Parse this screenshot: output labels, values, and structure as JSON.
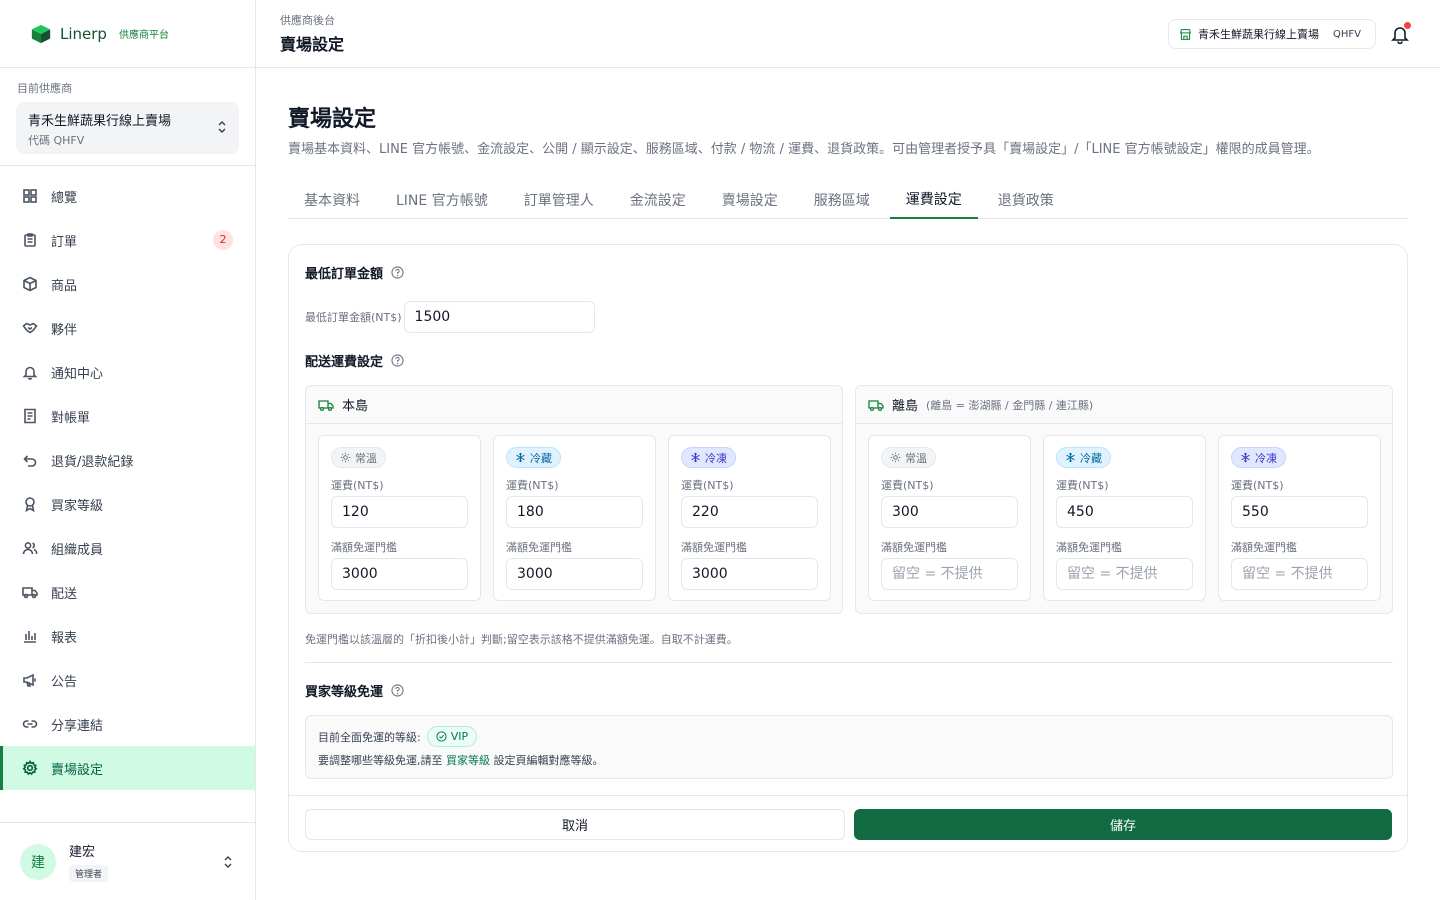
{
  "brand": {
    "name": "Linerp",
    "sub": "供應商平台"
  },
  "supplier": {
    "label": "目前供應商",
    "name": "青禾生鮮蔬果行線上賣場",
    "code": "代碼 QHFV"
  },
  "nav": [
    {
      "label": "總覽",
      "icon": "grid-icon"
    },
    {
      "label": "訂單",
      "icon": "clipboard-icon",
      "badge": "2"
    },
    {
      "label": "商品",
      "icon": "box-icon"
    },
    {
      "label": "夥伴",
      "icon": "handshake-icon"
    },
    {
      "label": "通知中心",
      "icon": "bell-icon"
    },
    {
      "label": "對帳單",
      "icon": "receipt-icon"
    },
    {
      "label": "退貨/退款紀錄",
      "icon": "undo-icon"
    },
    {
      "label": "買家等級",
      "icon": "award-icon"
    },
    {
      "label": "組織成員",
      "icon": "users-icon"
    },
    {
      "label": "配送",
      "icon": "truck-icon"
    },
    {
      "label": "報表",
      "icon": "bar-chart-icon"
    },
    {
      "label": "公告",
      "icon": "megaphone-icon"
    },
    {
      "label": "分享連結",
      "icon": "link-icon"
    },
    {
      "label": "賣場設定",
      "icon": "gear-icon",
      "active": true
    }
  ],
  "user": {
    "initial": "建",
    "name": "建宏",
    "role": "管理者"
  },
  "topbar": {
    "crumb": "供應商後台",
    "title": "賣場設定",
    "store_name": "青禾生鮮蔬果行線上賣場",
    "store_code": "QHFV"
  },
  "page": {
    "title": "賣場設定",
    "desc": "賣場基本資料、LINE 官方帳號、金流設定、公開 / 顯示設定、服務區域、付款 / 物流 / 運費、退貨政策。可由管理者授予具「賣場設定」/「LINE 官方帳號設定」權限的成員管理。"
  },
  "tabs": [
    "基本資料",
    "LINE 官方帳號",
    "訂單管理人",
    "金流設定",
    "賣場設定",
    "服務區域",
    "運費設定",
    "退貨政策"
  ],
  "active_tab": "運費設定",
  "min_order": {
    "heading": "最低訂單金額",
    "label": "最低訂單金額(NT$)",
    "value": "1500"
  },
  "shipping": {
    "heading": "配送運費設定",
    "fee_label": "運費(NT$)",
    "threshold_label": "滿額免運門檻",
    "main": {
      "title": "本島",
      "temps": [
        {
          "label": "常溫",
          "kind": "normal",
          "fee": "120",
          "threshold": "3000"
        },
        {
          "label": "冷藏",
          "kind": "chill",
          "fee": "180",
          "threshold": "3000"
        },
        {
          "label": "冷凍",
          "kind": "freeze",
          "fee": "220",
          "threshold": "3000"
        }
      ]
    },
    "outer": {
      "title": "離島",
      "note": "(離島 = 澎湖縣 / 金門縣 / 連江縣)",
      "temps": [
        {
          "label": "常溫",
          "kind": "normal",
          "fee": "300",
          "threshold": "",
          "placeholder": "留空 = 不提供"
        },
        {
          "label": "冷藏",
          "kind": "chill",
          "fee": "450",
          "threshold": "",
          "placeholder": "留空 = 不提供"
        },
        {
          "label": "冷凍",
          "kind": "freeze",
          "fee": "550",
          "threshold": "",
          "placeholder": "留空 = 不提供"
        }
      ]
    },
    "footnote": "免運門檻以該溫層的「折扣後小計」判斷;留空表示該格不提供滿額免運。自取不計運費。"
  },
  "tier": {
    "heading": "買家等級免運",
    "current_label": "目前全面免運的等級:",
    "badge": "VIP",
    "hint_pre": "要調整哪些等級免運,請至",
    "hint_link": "買家等級",
    "hint_post": "設定頁編輯對應等級。"
  },
  "actions": {
    "cancel": "取消",
    "save": "儲存"
  },
  "colors": {
    "brand": "#116a42",
    "active_bg": "#d1fae5",
    "badge_red": "#dc2626"
  }
}
